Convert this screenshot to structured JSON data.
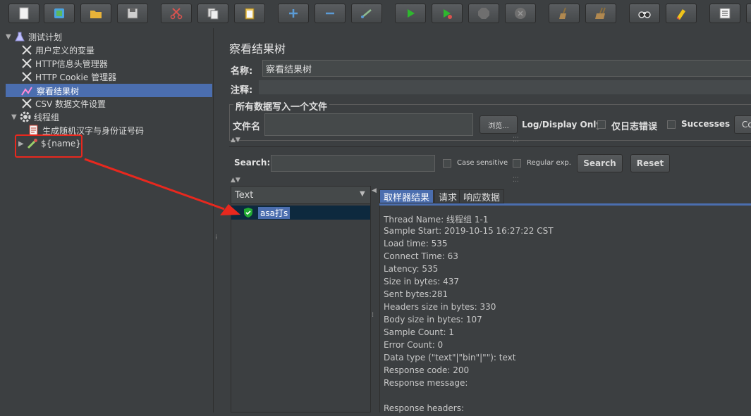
{
  "toolbar": {
    "buttons": [
      {
        "name": "new-icon",
        "color": "#f2f2f2"
      },
      {
        "name": "templates-icon",
        "color": "#5cb85c"
      },
      {
        "name": "open-icon",
        "color": "#e8b339"
      },
      {
        "name": "save-icon",
        "color": "#d8d8d8"
      },
      {
        "name": "cut-icon",
        "color": "#d9534f"
      },
      {
        "name": "copy-icon",
        "color": "#d8d8d8"
      },
      {
        "name": "paste-icon",
        "color": "#e8c35a"
      },
      {
        "name": "expand-icon",
        "color": "#5b9bd5"
      },
      {
        "name": "collapse-icon",
        "color": "#5b9bd5"
      },
      {
        "name": "toggle-icon",
        "color": "#8fbc8f"
      },
      {
        "name": "start-icon",
        "color": "#2eb82e"
      },
      {
        "name": "start-no-pauses-icon",
        "color": "#2eb82e"
      },
      {
        "name": "stop-icon",
        "color": "#777777"
      },
      {
        "name": "shutdown-icon",
        "color": "#777777"
      },
      {
        "name": "clear-icon",
        "color": "#b08850"
      },
      {
        "name": "clear-all-icon",
        "color": "#b08850"
      },
      {
        "name": "search-icon",
        "color": "#cccccc"
      },
      {
        "name": "reset-search-icon",
        "color": "#f0c419"
      },
      {
        "name": "function-helper-icon",
        "color": "#dddddd"
      }
    ]
  },
  "tree": {
    "items": [
      {
        "label": "测试计划",
        "icon": "flask-icon"
      },
      {
        "label": "用户定义的变量",
        "icon": "wrench-icon"
      },
      {
        "label": "HTTP信息头管理器",
        "icon": "wrench-icon"
      },
      {
        "label": "HTTP Cookie 管理器",
        "icon": "wrench-icon"
      },
      {
        "label": "察看结果树",
        "icon": "graph-icon",
        "selected": true
      },
      {
        "label": "CSV 数据文件设置",
        "icon": "wrench-icon"
      },
      {
        "label": "线程组",
        "icon": "gear-icon"
      },
      {
        "label": "生成随机汉字与身份证号码",
        "icon": "script-icon"
      },
      {
        "label": "${name}",
        "icon": "sampler-pipette-icon"
      }
    ]
  },
  "panel": {
    "title": "察看结果树",
    "name_label": "名称:",
    "name_value": "察看结果树",
    "comment_label": "注释:",
    "group_title": "所有数据写入一个文件",
    "file_label": "文件名",
    "browse_label": "浏览...",
    "log_only_label": "Log/Display Only:",
    "errors_label": "仅日志错误",
    "successes_label": "Successes",
    "configure_label": "Co"
  },
  "search": {
    "label": "Search:",
    "case_label": "Case sensitive",
    "regex_label": "Regular exp.",
    "search_button": "Search",
    "reset_button": "Reset"
  },
  "results": {
    "renderer": "Text",
    "samples": [
      {
        "label": "asa打s",
        "status": "success"
      }
    ],
    "tabs": [
      "取样器结果",
      "请求",
      "响应数据"
    ],
    "active_tab": 0,
    "details": [
      "Thread Name: 线程组 1-1",
      "Sample Start: 2019-10-15 16:27:22 CST",
      "Load time: 535",
      "Connect Time: 63",
      "Latency: 535",
      "Size in bytes: 437",
      "Sent bytes:281",
      "Headers size in bytes: 330",
      "Body size in bytes: 107",
      "Sample Count: 1",
      "Error Count: 0",
      "Data type (\"text\"|\"bin\"|\"\"): text",
      "Response code: 200",
      "Response message: ",
      "",
      "Response headers:"
    ]
  },
  "annotation": {
    "color": "#e8281e"
  }
}
